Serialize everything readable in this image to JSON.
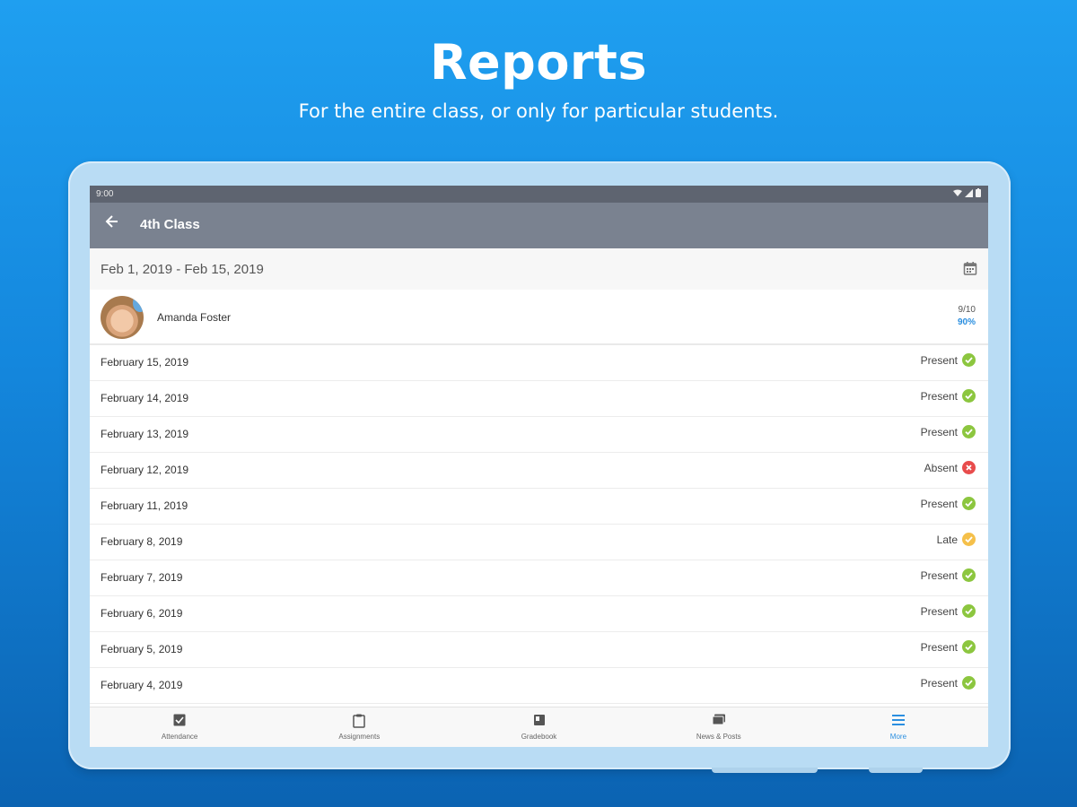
{
  "promo": {
    "title": "Reports",
    "subtitle": "For the entire class, or only for particular students."
  },
  "status_bar": {
    "time": "9:00"
  },
  "app_bar": {
    "title": "4th Class",
    "back_icon": "arrow-left-icon"
  },
  "date_range": {
    "value": "Feb 1, 2019 - Feb 15, 2019",
    "icon": "calendar-icon"
  },
  "student": {
    "name": "Amanda Foster",
    "fraction": "9/10",
    "percent": "90%"
  },
  "records": [
    {
      "date": "February 15, 2019",
      "status": "Present",
      "kind": "present"
    },
    {
      "date": "February 14, 2019",
      "status": "Present",
      "kind": "present"
    },
    {
      "date": "February 13, 2019",
      "status": "Present",
      "kind": "present"
    },
    {
      "date": "February 12, 2019",
      "status": "Absent",
      "kind": "absent"
    },
    {
      "date": "February 11, 2019",
      "status": "Present",
      "kind": "present"
    },
    {
      "date": "February 8, 2019",
      "status": "Late",
      "kind": "late"
    },
    {
      "date": "February 7, 2019",
      "status": "Present",
      "kind": "present"
    },
    {
      "date": "February 6, 2019",
      "status": "Present",
      "kind": "present"
    },
    {
      "date": "February 5, 2019",
      "status": "Present",
      "kind": "present"
    },
    {
      "date": "February 4, 2019",
      "status": "Present",
      "kind": "present"
    }
  ],
  "status_colors": {
    "present": "#8cc63f",
    "absent": "#e84c4c",
    "late": "#f5c04a"
  },
  "nav": [
    {
      "label": "Attendance",
      "icon": "checkbox-icon",
      "active": false
    },
    {
      "label": "Assignments",
      "icon": "clipboard-icon",
      "active": false
    },
    {
      "label": "Gradebook",
      "icon": "book-icon",
      "active": false
    },
    {
      "label": "News & Posts",
      "icon": "posts-icon",
      "active": false
    },
    {
      "label": "More",
      "icon": "menu-icon",
      "active": true
    }
  ],
  "colors": {
    "accent": "#2b8fe0",
    "appbar": "#7a8290",
    "background": "#1a8fe3"
  }
}
